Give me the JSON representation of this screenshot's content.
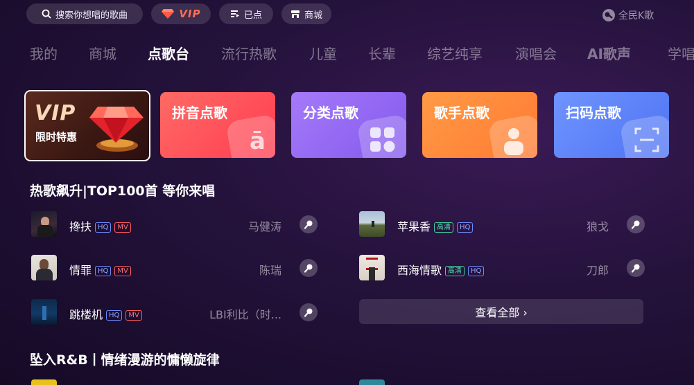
{
  "topbar": {
    "search_label": "搜索你想唱的歌曲",
    "vip_label": "VIP",
    "queued_label": "已点",
    "shop_label": "商城",
    "brand": "全民K歌"
  },
  "tabs": [
    "我的",
    "商城",
    "点歌台",
    "流行热歌",
    "儿童",
    "长辈",
    "综艺纯享",
    "演唱会",
    "AI歌声",
    "学唱"
  ],
  "active_tab": "点歌台",
  "cards": {
    "vip": {
      "line1": "VIP",
      "line2": "限时特惠"
    },
    "pinyin": "拼音点歌",
    "category": "分类点歌",
    "singer": "歌手点歌",
    "scan": "扫码点歌"
  },
  "section1": {
    "title": "热歌飙升|TOP100首 等你来唱",
    "left_songs": [
      {
        "title": "搀扶",
        "badges": [
          "HQ",
          "MV"
        ],
        "artist": "马健涛"
      },
      {
        "title": "情罪",
        "badges": [
          "HQ",
          "MV"
        ],
        "artist": "陈瑞"
      },
      {
        "title": "跳楼机",
        "badges": [
          "HQ",
          "MV"
        ],
        "artist": "LBI利比（时..."
      }
    ],
    "right_songs": [
      {
        "title": "苹果香",
        "badges": [
          "高清",
          "HQ"
        ],
        "artist": "狼戈"
      },
      {
        "title": "西海情歌",
        "badges": [
          "高清",
          "HQ"
        ],
        "artist": "刀郎"
      }
    ],
    "view_all": "查看全部 ›"
  },
  "section2": {
    "title": "坠入R&B丨情绪漫游的慵懒旋律"
  },
  "colors": {
    "accent_vip": "#ff6d54",
    "pinyin_card": "#ff5a64",
    "category_card": "#9b6cf6",
    "singer_card": "#ff8a3d",
    "scan_card": "#5f86ff"
  }
}
